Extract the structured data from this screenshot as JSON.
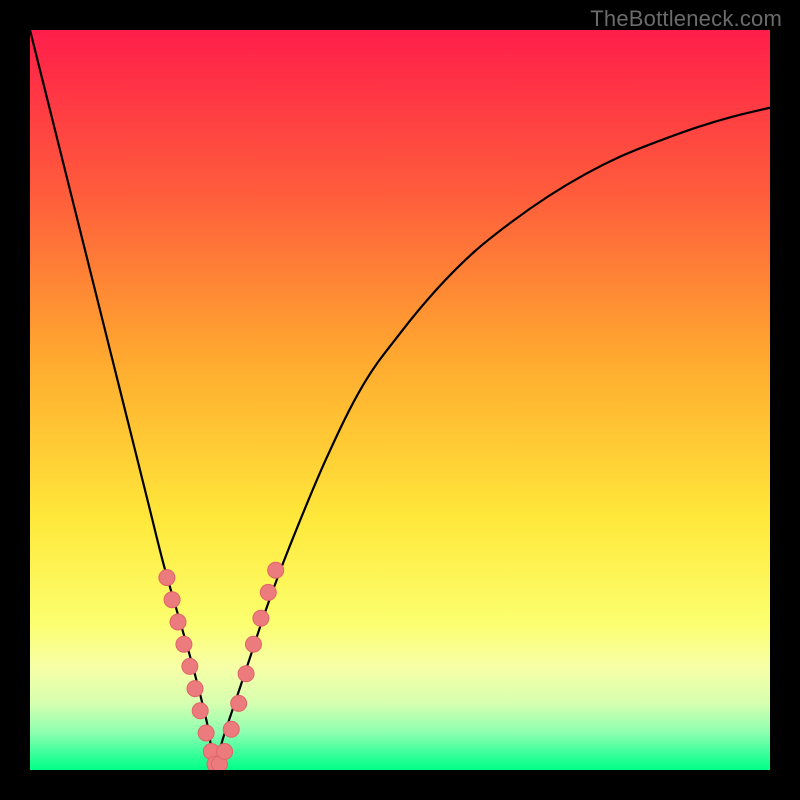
{
  "watermark": {
    "text": "TheBottleneck.com"
  },
  "chart_data": {
    "type": "line",
    "title": "",
    "xlabel": "",
    "ylabel": "",
    "xlim": [
      0,
      100
    ],
    "ylim": [
      0,
      100
    ],
    "grid": false,
    "legend": false,
    "background_gradient": {
      "stops": [
        {
          "pct": 0,
          "color": "#ff1e4a"
        },
        {
          "pct": 22,
          "color": "#ff5c3c"
        },
        {
          "pct": 45,
          "color": "#ffab2f"
        },
        {
          "pct": 66,
          "color": "#ffe83a"
        },
        {
          "pct": 80,
          "color": "#fcff6e"
        },
        {
          "pct": 86,
          "color": "#f7ffa6"
        },
        {
          "pct": 91,
          "color": "#d6ffb0"
        },
        {
          "pct": 95,
          "color": "#8cffb0"
        },
        {
          "pct": 98,
          "color": "#33ff99"
        },
        {
          "pct": 100,
          "color": "#00ff88"
        }
      ]
    },
    "series": [
      {
        "name": "bottleneck-curve",
        "color": "#000000",
        "x": [
          0,
          2,
          4,
          6,
          8,
          10,
          12,
          14,
          16,
          18,
          20,
          22,
          24,
          25,
          26,
          28,
          30,
          32,
          35,
          40,
          45,
          50,
          55,
          60,
          65,
          70,
          75,
          80,
          85,
          90,
          95,
          100
        ],
        "y": [
          100,
          92,
          84,
          76,
          68,
          60,
          52,
          44,
          36,
          28,
          21,
          14,
          6,
          0,
          4,
          10,
          16,
          22,
          30,
          42,
          52,
          59,
          65,
          70,
          74,
          77.5,
          80.5,
          83,
          85,
          86.8,
          88.3,
          89.5
        ]
      }
    ],
    "markers": {
      "name": "highlight-points",
      "color": "#ec7b7e",
      "stroke": "#e06468",
      "radius_px": 8,
      "points": [
        {
          "x": 18.5,
          "y": 26
        },
        {
          "x": 19.2,
          "y": 23
        },
        {
          "x": 20.0,
          "y": 20
        },
        {
          "x": 20.8,
          "y": 17
        },
        {
          "x": 21.6,
          "y": 14
        },
        {
          "x": 22.3,
          "y": 11
        },
        {
          "x": 23.0,
          "y": 8
        },
        {
          "x": 23.8,
          "y": 5
        },
        {
          "x": 24.5,
          "y": 2.5
        },
        {
          "x": 25.0,
          "y": 0.8
        },
        {
          "x": 25.6,
          "y": 0.8
        },
        {
          "x": 26.3,
          "y": 2.5
        },
        {
          "x": 27.2,
          "y": 5.5
        },
        {
          "x": 28.2,
          "y": 9
        },
        {
          "x": 29.2,
          "y": 13
        },
        {
          "x": 30.2,
          "y": 17
        },
        {
          "x": 31.2,
          "y": 20.5
        },
        {
          "x": 32.2,
          "y": 24
        },
        {
          "x": 33.2,
          "y": 27
        }
      ]
    }
  }
}
